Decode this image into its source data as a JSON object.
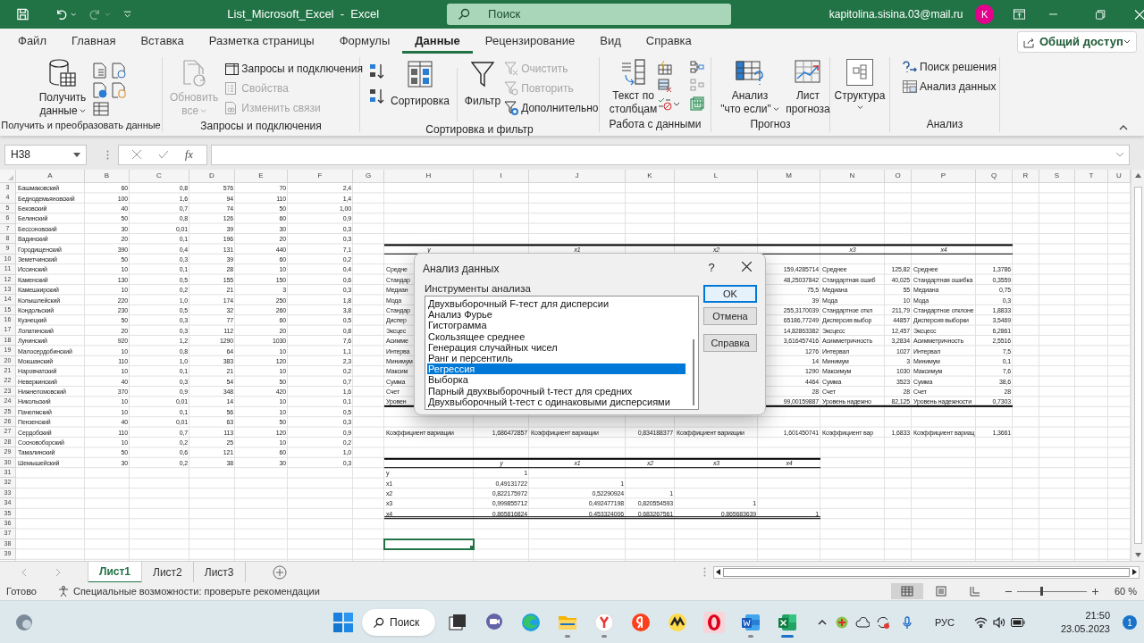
{
  "title_bar": {
    "document_title": "List_Microsoft_Excel  -  Excel",
    "search": {
      "placeholder": "Поиск"
    },
    "account": "kapitolina.sisina.03@mail.ru",
    "avatar": "K"
  },
  "menu_tabs": [
    {
      "label": "Файл",
      "selected": false
    },
    {
      "label": "Главная",
      "selected": false
    },
    {
      "label": "Вставка",
      "selected": false
    },
    {
      "label": "Разметка страницы",
      "selected": false
    },
    {
      "label": "Формулы",
      "selected": false
    },
    {
      "label": "Данные",
      "selected": true
    },
    {
      "label": "Рецензирование",
      "selected": false
    },
    {
      "label": "Вид",
      "selected": false
    },
    {
      "label": "Справка",
      "selected": false
    }
  ],
  "share_button": "Общий доступ",
  "ribbon": {
    "groups": [
      {
        "label": "Получить и преобразовать данные",
        "items": [
          {
            "label": "Получить данные",
            "disabled": false
          }
        ]
      },
      {
        "label": "Запросы и подключения",
        "items": [
          {
            "label": "Обновить все",
            "disabled": true
          },
          {
            "label": "Запросы и подключения",
            "disabled": false
          },
          {
            "label": "Свойства",
            "disabled": true
          },
          {
            "label": "Изменить связи",
            "disabled": true
          }
        ]
      },
      {
        "label": "Сортировка и фильтр",
        "items": [
          {
            "label": "Сортировка",
            "disabled": false
          },
          {
            "label": "Фильтр",
            "disabled": false
          },
          {
            "label": "Очистить",
            "disabled": true
          },
          {
            "label": "Повторить",
            "disabled": true
          },
          {
            "label": "Дополнительно",
            "disabled": false
          }
        ]
      },
      {
        "label": "Работа с данными",
        "items": [
          {
            "label": "Текст по столбцам",
            "disabled": false
          }
        ]
      },
      {
        "label": "Прогноз",
        "items": [
          {
            "label": "Анализ \"что если\"",
            "disabled": false
          },
          {
            "label": "Лист прогноза",
            "disabled": false
          }
        ]
      },
      {
        "items": [
          {
            "label": "Структура",
            "disabled": false
          }
        ]
      },
      {
        "label": "Анализ",
        "items": [
          {
            "label": "Поиск решения",
            "disabled": false
          },
          {
            "label": "Анализ данных",
            "disabled": false
          }
        ]
      }
    ]
  },
  "formula_bar": {
    "name_box": "H38",
    "function_button": "fx"
  },
  "grid": {
    "column_headers": [
      "A",
      "B",
      "C",
      "D",
      "E",
      "F",
      "G",
      "H",
      "I",
      "J",
      "K",
      "L",
      "M",
      "N",
      "O",
      "P",
      "Q",
      "R",
      "S",
      "T",
      "U"
    ],
    "rows": [
      {
        "number": "3",
        "kind": "plain",
        "cells": [
          "Башмаковский",
          "60",
          "0,8",
          "576",
          "70",
          "2,4"
        ]
      },
      {
        "number": "4",
        "kind": "plain",
        "cells": [
          "Беднодемьяновский",
          "100",
          "1,6",
          "94",
          "110",
          "1,4"
        ]
      },
      {
        "number": "5",
        "kind": "plain",
        "cells": [
          "Бековский",
          "40",
          "0,7",
          "74",
          "50",
          "1,00"
        ]
      },
      {
        "number": "6",
        "kind": "plain",
        "cells": [
          "Белинский",
          "50",
          "0,8",
          "126",
          "60",
          "0,9"
        ]
      },
      {
        "number": "7",
        "kind": "plain",
        "cells": [
          "Бессоновский",
          "30",
          "0,01",
          "39",
          "30",
          "0,3"
        ]
      },
      {
        "number": "8",
        "kind": "plain",
        "cells": [
          "Вадинский",
          "20",
          "0,1",
          "196",
          "20",
          "0,3"
        ]
      },
      {
        "number": "9",
        "kind": "heading",
        "cells": [
          "Городищенский",
          "390",
          "0,4",
          "131",
          "440",
          "7,1",
          null,
          "y",
          null,
          "x1",
          null,
          "x2",
          null,
          "x3",
          null,
          "x4"
        ]
      },
      {
        "number": "10",
        "kind": "plain",
        "cells": [
          "Земетчинский",
          "50",
          "0,3",
          "39",
          "60",
          "0,2"
        ]
      },
      {
        "number": "11",
        "kind": "stats",
        "cells": [
          "Иссинский",
          "10",
          "0,1",
          "28",
          "10",
          "0,4",
          null,
          "Средне",
          null,
          null,
          null,
          null,
          "159,4285714",
          "Среднее",
          "125,82",
          "Среднее",
          "1,3786"
        ]
      },
      {
        "number": "12",
        "kind": "stats",
        "cells": [
          "Каменский",
          "130",
          "0,5",
          "155",
          "150",
          "0,6",
          null,
          "Стандар",
          null,
          null,
          null,
          null,
          "48,25037842",
          "Стандартная ошиб",
          "40,025",
          "Стандартная ошибка",
          "0,3559"
        ]
      },
      {
        "number": "13",
        "kind": "stats",
        "cells": [
          "Камешкирский",
          "10",
          "0,2",
          "21",
          "3",
          "0,3",
          null,
          "Медиан",
          null,
          null,
          null,
          null,
          "75,5",
          "Медиана",
          "55",
          "Медиана",
          "0,75"
        ]
      },
      {
        "number": "14",
        "kind": "stats",
        "cells": [
          "Колышлейский",
          "220",
          "1,0",
          "174",
          "250",
          "1,8",
          null,
          "Мода",
          null,
          null,
          null,
          null,
          "39",
          "Мода",
          "10",
          "Мода",
          "0,3"
        ]
      },
      {
        "number": "15",
        "kind": "stats",
        "cells": [
          "Кондольский",
          "230",
          "0,5",
          "32",
          "260",
          "3,8",
          null,
          "Стандар",
          null,
          null,
          null,
          null,
          "255,3170039",
          "Стандартное откл",
          "211,79",
          "Стандартное отклоне",
          "1,8833"
        ]
      },
      {
        "number": "16",
        "kind": "stats",
        "cells": [
          "Кузнецкий",
          "50",
          "0,3",
          "77",
          "60",
          "0,5",
          null,
          "Диспер",
          null,
          null,
          null,
          null,
          "65186,77249",
          "Дисперсия выбор",
          "44857",
          "Дисперсия выборки",
          "3,5469"
        ]
      },
      {
        "number": "17",
        "kind": "stats",
        "cells": [
          "Лопатинский",
          "20",
          "0,3",
          "112",
          "20",
          "0,8",
          null,
          "Эксцес",
          null,
          null,
          null,
          null,
          "14,82863382",
          "Эксцесс",
          "12,457",
          "Эксцесс",
          "6,2861"
        ]
      },
      {
        "number": "18",
        "kind": "stats",
        "cells": [
          "Лунинский",
          "920",
          "1,2",
          "1290",
          "1030",
          "7,6",
          null,
          "Асимме",
          null,
          null,
          null,
          null,
          "3,616457416",
          "Асимметричность",
          "3,2834",
          "Асимметричность",
          "2,5516"
        ]
      },
      {
        "number": "19",
        "kind": "stats",
        "cells": [
          "Малосердобинский",
          "10",
          "0,8",
          "64",
          "10",
          "1,1",
          null,
          "Интерва",
          null,
          null,
          null,
          null,
          "1276",
          "Интервал",
          "1027",
          "Интервал",
          "7,5"
        ]
      },
      {
        "number": "20",
        "kind": "stats",
        "cells": [
          "Мокшанский",
          "110",
          "1,0",
          "383",
          "120",
          "2,3",
          null,
          "Минимум",
          null,
          null,
          null,
          null,
          "14",
          "Минимум",
          "3",
          "Минимум",
          "0,1"
        ]
      },
      {
        "number": "21",
        "kind": "stats",
        "cells": [
          "Наровчатский",
          "10",
          "0,1",
          "21",
          "10",
          "0,2",
          null,
          "Максим",
          null,
          null,
          null,
          null,
          "1290",
          "Максимум",
          "1030",
          "Максимум",
          "7,6"
        ]
      },
      {
        "number": "22",
        "kind": "stats",
        "cells": [
          "Неверкинский",
          "40",
          "0,3",
          "54",
          "50",
          "0,7",
          null,
          "Сумма",
          null,
          null,
          null,
          null,
          "4464",
          "Сумма",
          "3523",
          "Сумма",
          "38,6"
        ]
      },
      {
        "number": "23",
        "kind": "stats",
        "cells": [
          "Нижнеломовский",
          "370",
          "0,9",
          "348",
          "420",
          "1,6",
          null,
          "Счет",
          null,
          null,
          null,
          null,
          "28",
          "Счет",
          "28",
          "Счет",
          "28"
        ]
      },
      {
        "number": "24",
        "kind": "stats_end",
        "cells": [
          "Никольский",
          "10",
          "0,01",
          "14",
          "10",
          "0,1",
          null,
          "Уровен",
          null,
          null,
          null,
          null,
          "99,00159887",
          "Уровень надежно",
          "82,125",
          "Уровень надежности",
          "0,7303"
        ]
      },
      {
        "number": "25",
        "kind": "plain",
        "cells": [
          "Пачелмский",
          "10",
          "0,1",
          "56",
          "10",
          "0,5"
        ]
      },
      {
        "number": "26",
        "kind": "plain",
        "cells": [
          "Пензенский",
          "40",
          "0,01",
          "63",
          "50",
          "0,3"
        ]
      },
      {
        "number": "27",
        "kind": "stats",
        "cells": [
          "Сердобский",
          "110",
          "0,7",
          "113",
          "120",
          "0,9",
          null,
          "Коэффициент вариации",
          "1,686472857",
          "Коэффициент вариации",
          "0,834188377",
          "Коэффициент вариации",
          "1,601450741",
          "Коэффициент вар",
          "1,6833",
          "Коэффициент вариац",
          "1,3661"
        ]
      },
      {
        "number": "28",
        "kind": "plain",
        "cells": [
          "Сосновоборский",
          "10",
          "0,2",
          "25",
          "10",
          "0,2"
        ]
      },
      {
        "number": "29",
        "kind": "plain",
        "cells": [
          "Тамалинский",
          "50",
          "0,6",
          "121",
          "60",
          "1,0"
        ]
      },
      {
        "number": "30",
        "kind": "matrix_heading",
        "cells": [
          "Шемышейский",
          "30",
          "0,2",
          "38",
          "30",
          "0,3",
          null,
          null,
          "y",
          "x1",
          "x2",
          "x3",
          "x4"
        ]
      },
      {
        "number": "31",
        "kind": "matrix",
        "cells": [
          null,
          null,
          null,
          null,
          null,
          null,
          null,
          "y",
          "1"
        ]
      },
      {
        "number": "32",
        "kind": "matrix",
        "cells": [
          null,
          null,
          null,
          null,
          null,
          null,
          null,
          "x1",
          "0,49131722",
          "1"
        ]
      },
      {
        "number": "33",
        "kind": "matrix",
        "cells": [
          null,
          null,
          null,
          null,
          null,
          null,
          null,
          "x2",
          "0,822175972",
          "0,52290924",
          "1"
        ]
      },
      {
        "number": "34",
        "kind": "matrix",
        "cells": [
          null,
          null,
          null,
          null,
          null,
          null,
          null,
          "x3",
          "0,999855712",
          "0,492477198",
          "0,820554593",
          "1"
        ]
      },
      {
        "number": "35",
        "kind": "matrix_end",
        "cells": [
          null,
          null,
          null,
          null,
          null,
          null,
          null,
          "x4",
          "0,865816824",
          "0,453324006",
          "0,683267561",
          "0,865683639",
          "1"
        ]
      },
      {
        "number": "36",
        "kind": "plain"
      },
      {
        "number": "37",
        "kind": "plain"
      },
      {
        "number": "38",
        "kind": "plain",
        "cells": [
          null,
          null,
          null,
          null,
          null,
          null,
          null,
          {
            "selected": true
          }
        ]
      },
      {
        "number": "39",
        "kind": "plain"
      }
    ]
  },
  "dialog": {
    "title": "Анализ данных",
    "help": "?",
    "label": "Инструменты анализа",
    "tools": [
      {
        "label": "Двухвыборочный F-тест для дисперсии",
        "selected": false
      },
      {
        "label": "Анализ Фурье",
        "selected": false
      },
      {
        "label": "Гистограмма",
        "selected": false
      },
      {
        "label": "Скользящее среднее",
        "selected": false
      },
      {
        "label": "Генерация случайных чисел",
        "selected": false
      },
      {
        "label": "Ранг и персентиль",
        "selected": false
      },
      {
        "label": "Регрессия",
        "selected": true
      },
      {
        "label": "Выборка",
        "selected": false
      },
      {
        "label": "Парный двухвыборочный t-тест для средних",
        "selected": false
      },
      {
        "label": "Двухвыборочный t-тест с одинаковыми дисперсиями",
        "selected": false
      }
    ],
    "buttons": [
      "OK",
      "Отмена",
      "Справка"
    ]
  },
  "sheet_tabs": [
    {
      "label": "Лист1",
      "selected": true
    },
    {
      "label": "Лист2",
      "selected": false
    },
    {
      "label": "Лист3",
      "selected": false
    }
  ],
  "status_bar": {
    "status": "Готово",
    "accessibility": "Специальные возможности: проверьте рекомендации",
    "views": [
      {
        "kind": "normal",
        "selected": true
      },
      {
        "kind": "page_layout",
        "selected": false
      },
      {
        "kind": "page_break",
        "selected": false
      }
    ],
    "zoom": {
      "level": 0.35,
      "reading": "60 %"
    }
  },
  "taskbar": {
    "search": "Поиск",
    "apps": [
      {
        "kind": "task_view",
        "running": false,
        "active": false
      },
      {
        "kind": "chat",
        "running": false,
        "active": false
      },
      {
        "kind": "edge",
        "running": false,
        "active": false
      },
      {
        "kind": "explorer",
        "running": true,
        "active": false
      },
      {
        "kind": "browser",
        "running": true,
        "active": false
      },
      {
        "kind": "yandex",
        "running": false,
        "active": false
      },
      {
        "kind": "music",
        "running": false,
        "active": false
      },
      {
        "kind": "opera",
        "running": false,
        "active": false
      },
      {
        "kind": "word",
        "running": true,
        "active": false
      },
      {
        "kind": "excel",
        "running": true,
        "active": true
      }
    ],
    "language": "РУС",
    "time": "21:50",
    "date": "23.05.2023",
    "notifications": "1"
  }
}
